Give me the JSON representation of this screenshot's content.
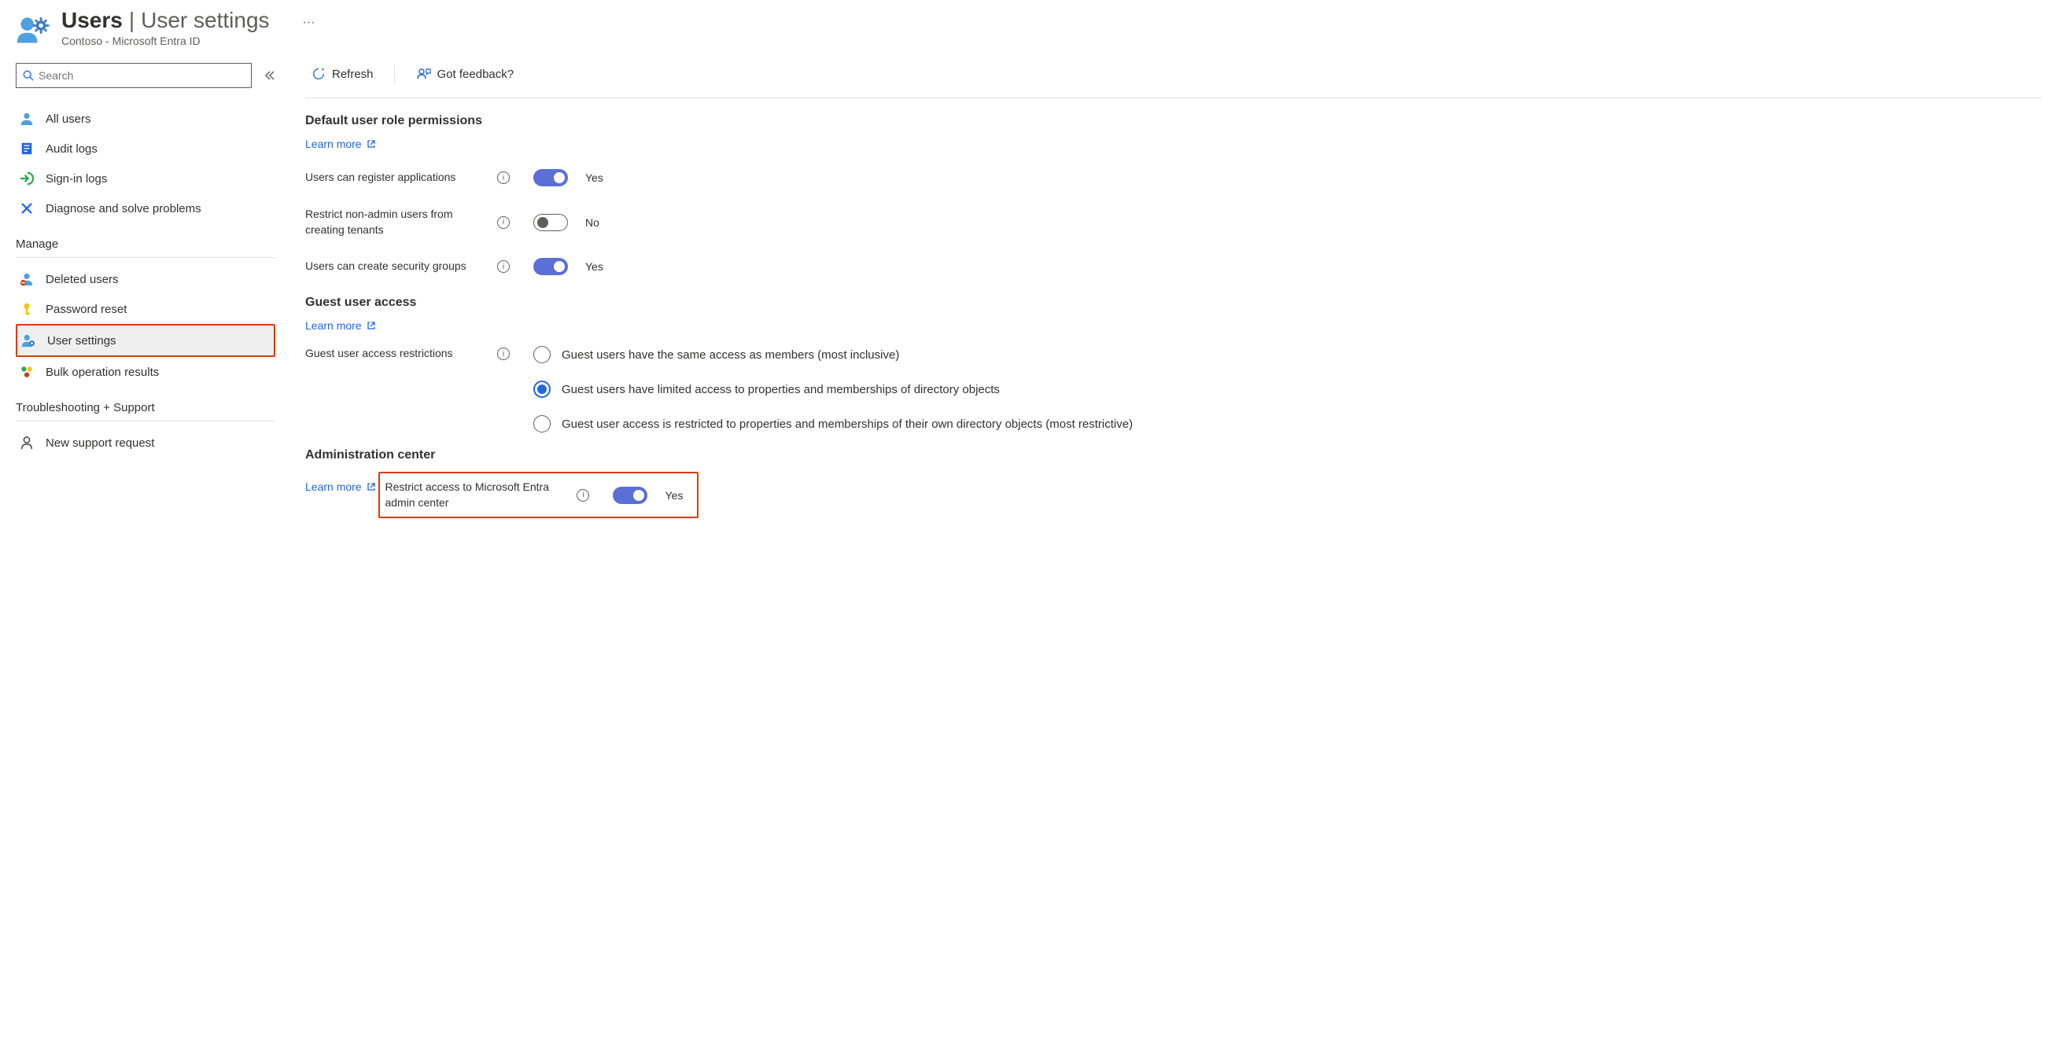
{
  "header": {
    "title_bold": "Users",
    "title_sep": "|",
    "title_light": "User settings",
    "subtitle": "Contoso - Microsoft Entra ID",
    "ellipsis": "···"
  },
  "sidebar": {
    "search_placeholder": "Search",
    "items_top": [
      {
        "label": "All users"
      },
      {
        "label": "Audit logs"
      },
      {
        "label": "Sign-in logs"
      },
      {
        "label": "Diagnose and solve problems"
      }
    ],
    "section_manage": "Manage",
    "items_manage": [
      {
        "label": "Deleted users"
      },
      {
        "label": "Password reset"
      },
      {
        "label": "User settings"
      },
      {
        "label": "Bulk operation results"
      }
    ],
    "section_troubleshoot": "Troubleshooting + Support",
    "items_troubleshoot": [
      {
        "label": "New support request"
      }
    ]
  },
  "toolbar": {
    "refresh": "Refresh",
    "feedback": "Got feedback?"
  },
  "sections": {
    "default": {
      "title": "Default user role permissions",
      "learn_more": "Learn more",
      "settings": [
        {
          "label": "Users can register applications",
          "value": "Yes",
          "on": true
        },
        {
          "label": "Restrict non-admin users from creating tenants",
          "value": "No",
          "on": false
        },
        {
          "label": "Users can create security groups",
          "value": "Yes",
          "on": true
        }
      ]
    },
    "guest": {
      "title": "Guest user access",
      "learn_more": "Learn more",
      "label": "Guest user access restrictions",
      "options": [
        "Guest users have the same access as members (most inclusive)",
        "Guest users have limited access to properties and memberships of directory objects",
        "Guest user access is restricted to properties and memberships of their own directory objects (most restrictive)"
      ],
      "selected": 1
    },
    "admin": {
      "title": "Administration center",
      "learn_more": "Learn more",
      "settings": [
        {
          "label": "Restrict access to Microsoft Entra admin center",
          "value": "Yes",
          "on": true
        }
      ]
    }
  }
}
